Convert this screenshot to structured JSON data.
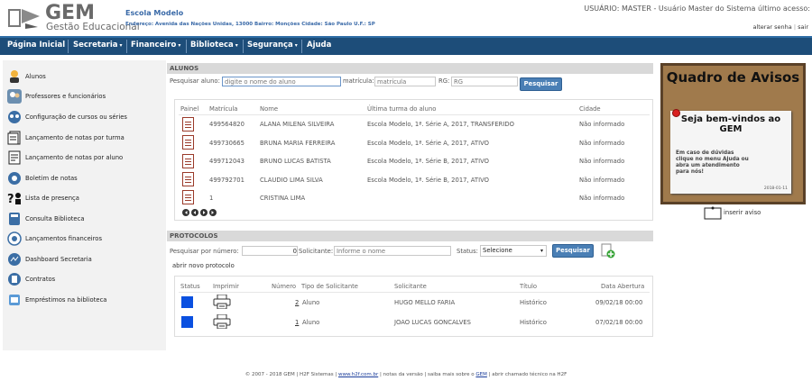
{
  "header": {
    "logo_title": "GEM",
    "logo_subtitle": "Gestão Educacional",
    "school_name": "Escola Modelo",
    "school_address": "Endereço: Avenida das Nações Unidas, 13000 Bairro: Monções Cidade: São Paulo U.F.: SP",
    "user_info": "USUÁRIO: MASTER - Usuário Master do Sistema último acesso:",
    "change_password": "alterar senha",
    "link_separator": "|",
    "logout": "sair"
  },
  "nav": {
    "items": [
      {
        "label": "Página Inicial",
        "dropdown": false
      },
      {
        "label": "Secretaria",
        "dropdown": true
      },
      {
        "label": "Financeiro",
        "dropdown": true
      },
      {
        "label": "Biblioteca",
        "dropdown": true
      },
      {
        "label": "Segurança",
        "dropdown": true
      },
      {
        "label": "Ajuda",
        "dropdown": false
      }
    ],
    "caret": "▾"
  },
  "sidebar": {
    "items": [
      {
        "label": "Alunos",
        "icon": "student-icon"
      },
      {
        "label": "Professores e funcionários",
        "icon": "staff-icon"
      },
      {
        "label": "Configuração de cursos ou séries",
        "icon": "settings-icon"
      },
      {
        "label": "Lançamento de notas por turma",
        "icon": "grades-class-icon"
      },
      {
        "label": "Lançamento de notas por aluno",
        "icon": "grades-student-icon"
      },
      {
        "label": "Boletim de notas",
        "icon": "report-card-icon"
      },
      {
        "label": "Lista de presença",
        "icon": "attendance-icon"
      },
      {
        "label": "Consulta Biblioteca",
        "icon": "library-icon"
      },
      {
        "label": "Lançamentos financeiros",
        "icon": "finance-icon"
      },
      {
        "label": "Dashboard Secretaria",
        "icon": "dashboard-icon"
      },
      {
        "label": "Contratos",
        "icon": "contracts-icon"
      },
      {
        "label": "Empréstimos na biblioteca",
        "icon": "loans-icon"
      }
    ]
  },
  "alunos": {
    "title": "ALUNOS",
    "search_label": "Pesquisar aluno:",
    "search_placeholder": "digite o nome do aluno",
    "matricula_label": "matrícula:",
    "matricula_placeholder": "matrícula",
    "rg_label": "RG:",
    "rg_placeholder": "RG",
    "search_button": "Pesquisar",
    "columns": [
      "Painel",
      "Matrícula",
      "Nome",
      "Última turma do aluno",
      "Cidade"
    ],
    "rows": [
      {
        "matricula": "499564820",
        "nome": "ALANA MILENA SILVEIRA",
        "turma": "Escola Modelo, 1ª. Série A, 2017, TRANSFERIDO",
        "cidade": "Não informado"
      },
      {
        "matricula": "499730665",
        "nome": "BRUNA MARIA FERREIRA",
        "turma": "Escola Modelo, 1ª. Série A, 2017, ATIVO",
        "cidade": "Não informado"
      },
      {
        "matricula": "499712043",
        "nome": "BRUNO LUCAS BATISTA",
        "turma": "Escola Modelo, 1ª. Série B, 2017, ATIVO",
        "cidade": "Não informado"
      },
      {
        "matricula": "499792701",
        "nome": "CLAUDIO LIMA SILVA",
        "turma": "Escola Modelo, 1ª. Série B, 2017, ATIVO",
        "cidade": "Não informado"
      },
      {
        "matricula": "1",
        "nome": "CRISTINA LIMA",
        "turma": "",
        "cidade": "Não informado"
      }
    ]
  },
  "protocolos": {
    "title": "PROTOCOLOS",
    "search_label": "Pesquisar por número:",
    "number_value": "0",
    "solicitante_label": "Solicitante:",
    "solicitante_placeholder": "Informe o nome",
    "status_label": "Status:",
    "status_selected": "Selecione",
    "search_button": "Pesquisar",
    "new_link": "abrir novo protocolo",
    "columns": [
      "Status",
      "Imprimir",
      "Número",
      "Tipo de Solicitante",
      "Solicitante",
      "Título",
      "Data Abertura"
    ],
    "rows": [
      {
        "numero": "2",
        "tipo": "Aluno",
        "solicitante": "HUGO MELLO FARIA",
        "titulo": "Histórico",
        "data": "09/02/18 00:00",
        "status_color": "#0a50e0"
      },
      {
        "numero": "1",
        "tipo": "Aluno",
        "solicitante": "JOAO LUCAS GONCALVES",
        "titulo": "Histórico",
        "data": "07/02/18 00:00",
        "status_color": "#0a50e0"
      }
    ]
  },
  "board": {
    "title": "Quadro de Avisos",
    "note_title": "Seja bem-vindos ao GEM",
    "note_text": "Em caso de dúvidas clique no menu Ajuda ou abra um atendimento para nós!",
    "note_date": "2018-01-11",
    "insert_link": "inserir aviso"
  },
  "footer": {
    "text1": "© 2007 - 2018 GEM | H2F Sistemas |",
    "site": "www.h2f.com.br",
    "text2": "| notas da versão | saiba mais sobre o",
    "gem": "GEM",
    "text3": "| abrir chamado técnico na H2F"
  },
  "colors": {
    "nav_bg": "#1d4d79",
    "button": "#4a7fb5",
    "status_blue": "#0a50e0",
    "board_cork": "#a07a4c"
  }
}
